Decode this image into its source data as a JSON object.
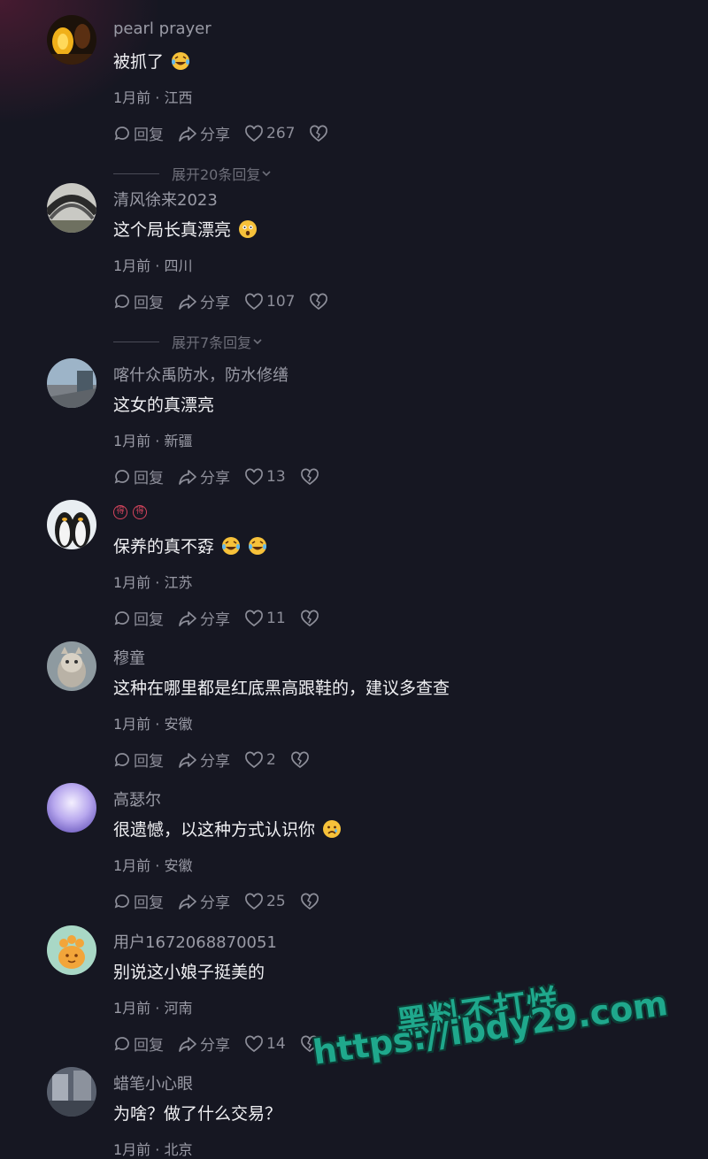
{
  "actions": {
    "reply": "回复",
    "share": "分享"
  },
  "comments": [
    {
      "username": "pearl prayer",
      "text": "被抓了",
      "emojis": [
        "laughing-tears-emoji"
      ],
      "meta": "1月前 · 江西",
      "likes": "267",
      "expand": "展开20条回复"
    },
    {
      "username": "清风徐来2023",
      "text": "这个局长真漂亮",
      "emojis": [
        "shocked-emoji"
      ],
      "meta": "1月前 · 四川",
      "likes": "107",
      "expand": "展开7条回复"
    },
    {
      "username": "喀什众禹防水，防水修缮",
      "text": "这女的真漂亮",
      "emojis": [],
      "meta": "1月前 · 新疆",
      "likes": "13"
    },
    {
      "username": "",
      "badges": [
        "得",
        "得"
      ],
      "text": "保养的真不孬",
      "emojis": [
        "laughing-tears-emoji",
        "laughing-tears-emoji"
      ],
      "meta": "1月前 · 江苏",
      "likes": "11"
    },
    {
      "username": "穆童",
      "text": "这种在哪里都是红底黑高跟鞋的，建议多查查",
      "emojis": [],
      "meta": "1月前 · 安徽",
      "likes": "2"
    },
    {
      "username": "高瑟尔",
      "text": "很遗憾，以这种方式认识你",
      "emojis": [
        "sad-emoji"
      ],
      "meta": "1月前 · 安徽",
      "likes": "25"
    },
    {
      "username": "用户1672068870051",
      "text": "别说这小娘子挺美的",
      "emojis": [],
      "meta": "1月前 · 河南",
      "likes": "14"
    },
    {
      "username": "蜡笔小心眼",
      "text": "为啥？做了什么交易？",
      "emojis": [],
      "meta": "1月前 · 北京"
    }
  ],
  "watermark": {
    "line1": "黑料不打烊",
    "line2": "https://ibdy29.com"
  },
  "colors": {
    "background": "#161722",
    "text": "#f0f0f3",
    "muted": "#9a9ba6",
    "watermark": "#1fa88c"
  }
}
